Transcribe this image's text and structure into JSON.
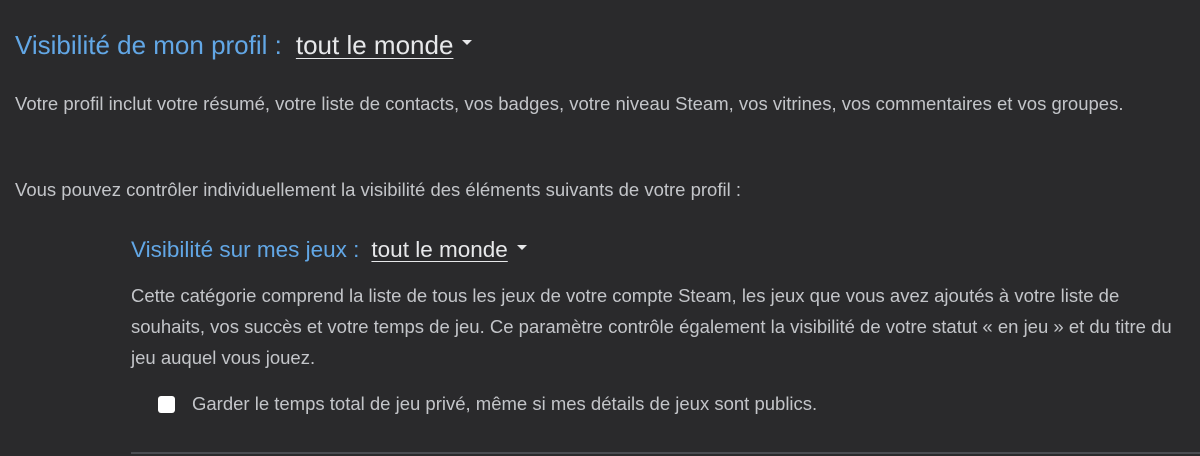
{
  "profile_visibility": {
    "label": "Visibilité de mon profil :",
    "value": "tout le monde",
    "description": "Votre profil inclut votre résumé, votre liste de contacts, vos badges, votre niveau Steam, vos vitrines, vos commentaires et vos groupes.",
    "control_note": "Vous pouvez contrôler individuellement la visibilité des éléments suivants de votre profil :"
  },
  "games_visibility": {
    "label": "Visibilité sur mes jeux :",
    "value": "tout le monde",
    "description": "Cette catégorie comprend la liste de tous les jeux de votre compte Steam, les jeux que vous avez ajoutés à votre liste de souhaits, vos succès et votre temps de jeu. Ce paramètre contrôle également la visibilité de votre statut « en jeu » et du titre du jeu auquel vous jouez.",
    "checkbox_label": "Garder le temps total de jeu privé, même si mes détails de jeux sont publics.",
    "checkbox_checked": false
  },
  "colors": {
    "background": "#2a2a2c",
    "label_blue": "#62a7e6",
    "text": "#c3c5c9"
  },
  "icons": {
    "dropdown": "caret-down-icon",
    "checkbox": "checkbox-icon"
  }
}
